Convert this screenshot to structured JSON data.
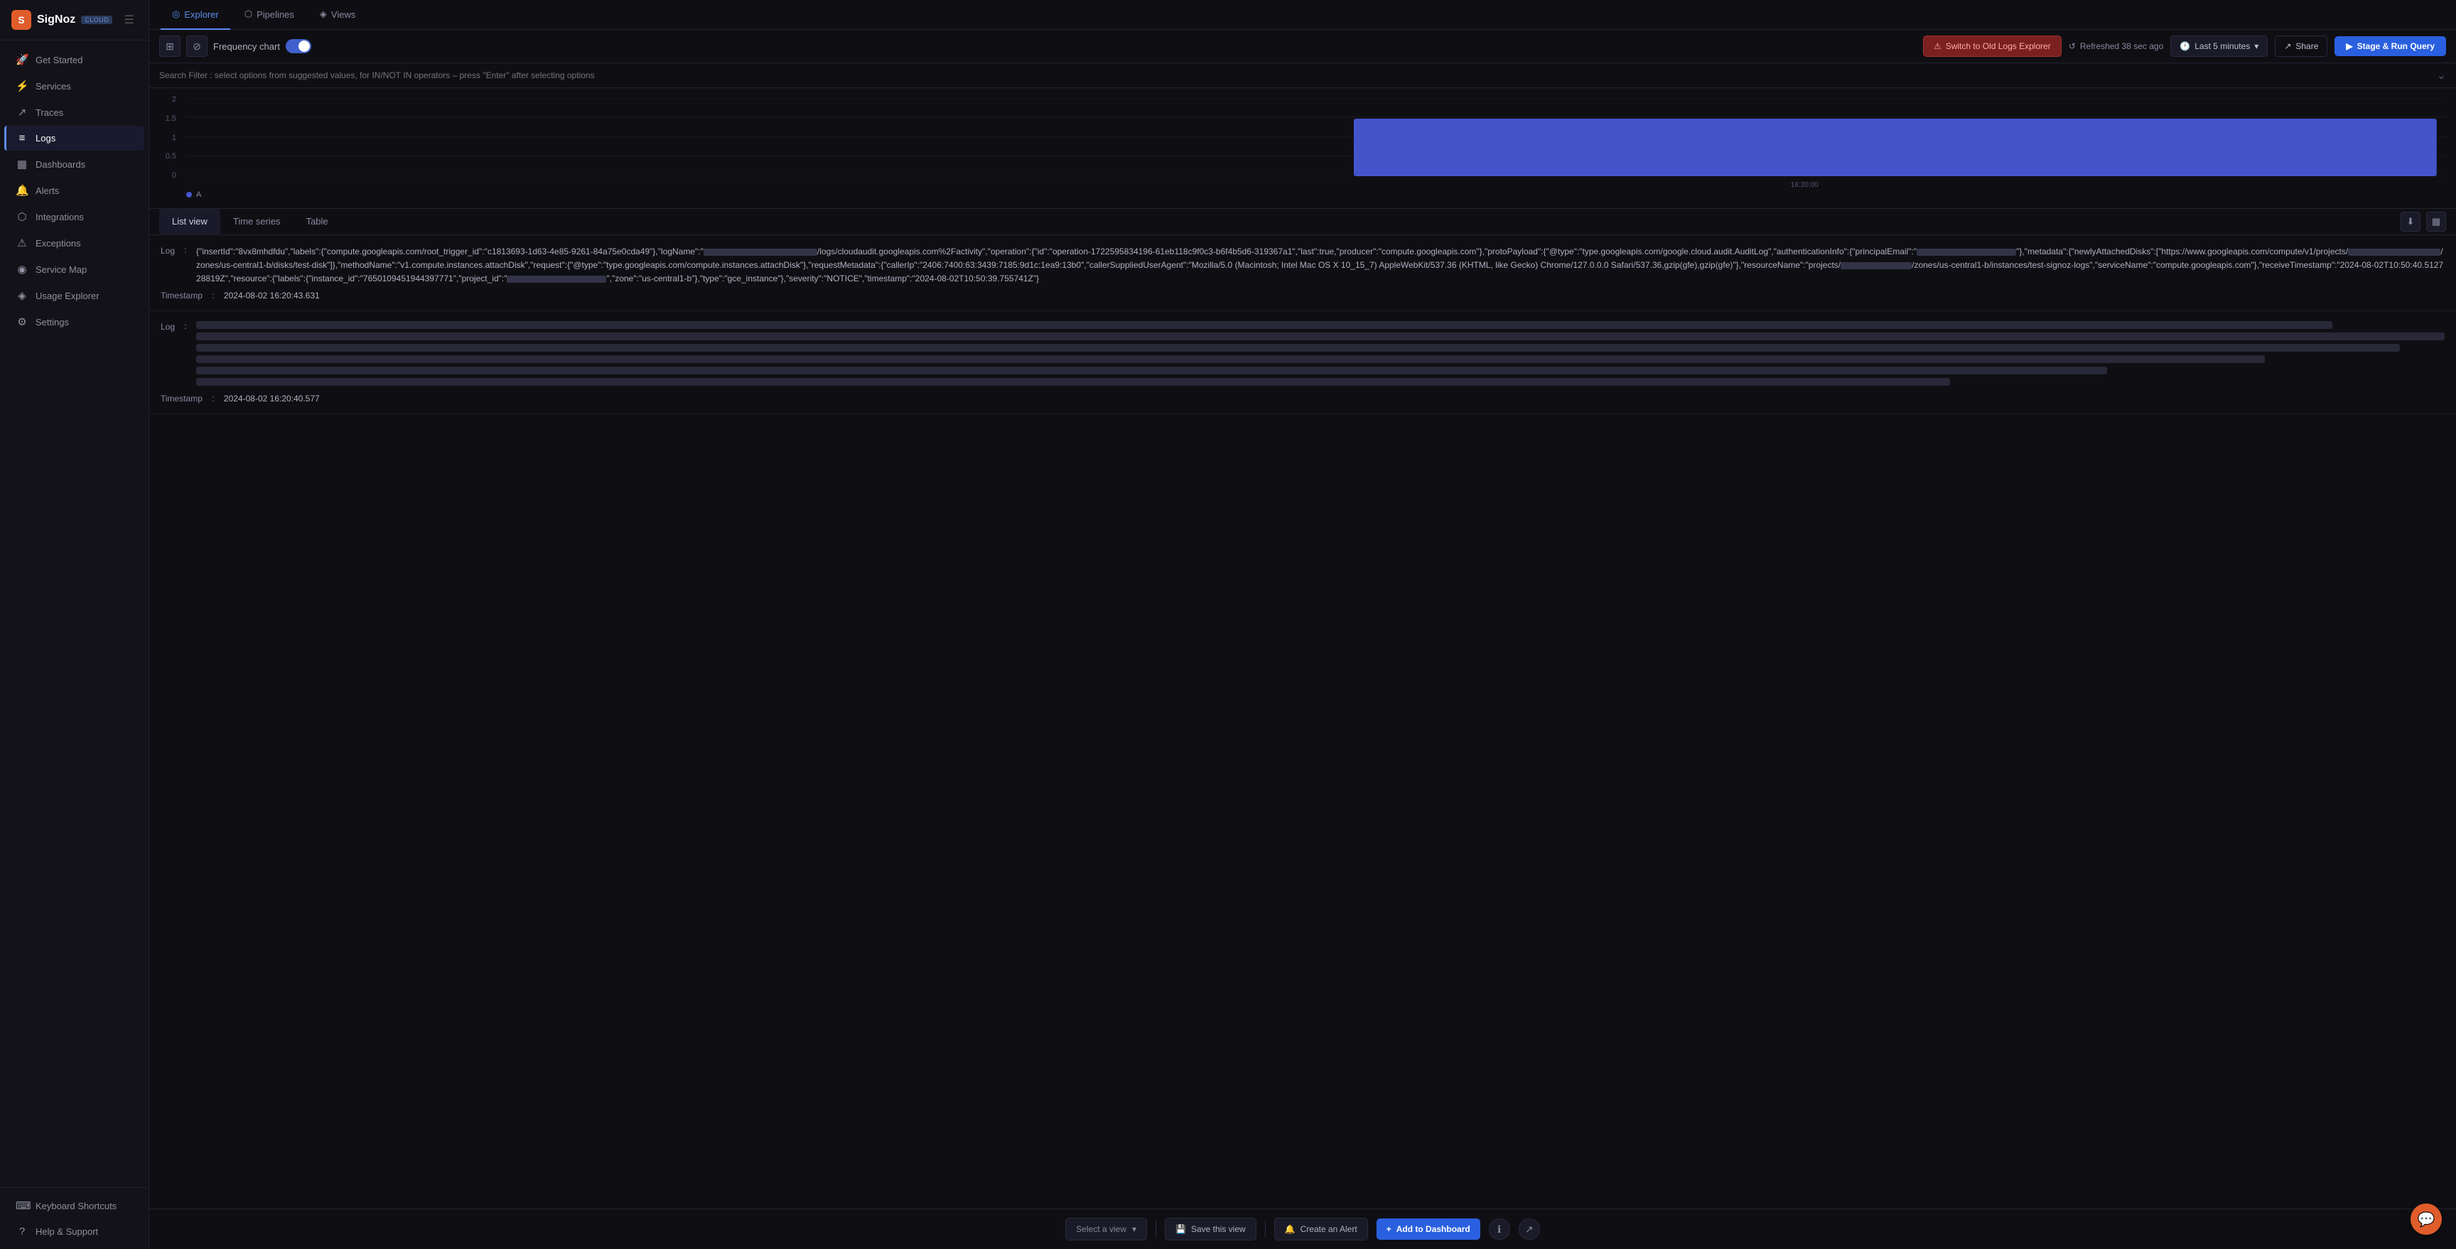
{
  "app": {
    "name": "SigNoz",
    "badge": "CLOUD"
  },
  "sidebar": {
    "items": [
      {
        "id": "get-started",
        "label": "Get Started",
        "icon": "🚀",
        "active": false
      },
      {
        "id": "services",
        "label": "Services",
        "icon": "⚡",
        "active": false
      },
      {
        "id": "traces",
        "label": "Traces",
        "icon": "↗",
        "active": false
      },
      {
        "id": "logs",
        "label": "Logs",
        "icon": "≡",
        "active": true
      },
      {
        "id": "dashboards",
        "label": "Dashboards",
        "icon": "▦",
        "active": false
      },
      {
        "id": "alerts",
        "label": "Alerts",
        "icon": "🔔",
        "active": false
      },
      {
        "id": "integrations",
        "label": "Integrations",
        "icon": "⬡",
        "active": false
      },
      {
        "id": "exceptions",
        "label": "Exceptions",
        "icon": "⚠",
        "active": false
      },
      {
        "id": "service-map",
        "label": "Service Map",
        "icon": "◉",
        "active": false
      },
      {
        "id": "usage-explorer",
        "label": "Usage Explorer",
        "icon": "◈",
        "active": false
      },
      {
        "id": "settings",
        "label": "Settings",
        "icon": "⚙",
        "active": false
      }
    ],
    "bottom_items": [
      {
        "id": "keyboard-shortcuts",
        "label": "Keyboard Shortcuts",
        "icon": "⌨"
      },
      {
        "id": "help-support",
        "label": "Help & Support",
        "icon": "?"
      }
    ]
  },
  "tabs": [
    {
      "id": "explorer",
      "label": "Explorer",
      "icon": "◎",
      "active": true
    },
    {
      "id": "pipelines",
      "label": "Pipelines",
      "icon": "⬡",
      "active": false
    },
    {
      "id": "views",
      "label": "Views",
      "icon": "◈",
      "active": false
    }
  ],
  "toolbar": {
    "freq_chart_label": "Frequency chart",
    "toggle_on": true,
    "switch_old_btn": "Switch to Old Logs Explorer",
    "refresh_text": "Refreshed 38 sec ago",
    "time_range": "Last 5 minutes",
    "share_label": "Share",
    "stage_run_label": "Stage & Run Query"
  },
  "search": {
    "placeholder": "Search Filter : select options from suggested values, for IN/NOT IN operators – press \"Enter\" after selecting options"
  },
  "chart": {
    "y_axis": [
      "2",
      "1.5",
      "1",
      "0.5",
      "0"
    ],
    "x_label": "16:20:00",
    "legend": "A",
    "bar_color": "#4455cc"
  },
  "view_tabs": [
    {
      "id": "list-view",
      "label": "List view",
      "active": true
    },
    {
      "id": "time-series",
      "label": "Time series",
      "active": false
    },
    {
      "id": "table",
      "label": "Table",
      "active": false
    }
  ],
  "logs": [
    {
      "id": "log-1",
      "label": "Log",
      "text": "{\"insertId\":\"8vx8mhdfdu\",\"labels\":{\"compute.googleapis.com/root_trigger_id\":\"c1813693-1d63-4e85-9261-84a75e0cda49\"},\"logName\":\"████████████████████/logs/cloudaudit.googleapis.com%2Factivity\",\"operation\":{\"id\":\"operation-1722595834196-61eb118c9f0c3-b6f4b5d6-319367a1\",\"last\":true,\"producer\":\"compute.googleapis.com\"},\"protoPayload\":{\"@type\":\"type.googleapis.com/google.cloud.audit.AuditLog\",\"authenticationInfo\":{\"principalEmail\":\"████████████████████\"},\"metadata\":{\"newlyAttachedDisks\":[\"https://www.googleapis.com/compute/v1/projects/████████████████████/zones/us-central1-b/disks/test-disk\"]},\"methodName\":\"v1.compute.instances.attachDisk\",\"request\":{\"@type\":\"type.googleapis.com/compute.instances.attachDisk\"},\"requestMetadata\":{\"callerIp\":\"2406:7400:63:3439:7185:9d1c:1ea9:13b0\",\"callerSuppliedUserAgent\":\"Mozilla/5.0 (Macintosh; Intel Mac OS X 10_15_7) AppleWebKit/537.36 (KHTML, like Gecko) Chrome/127.0.0.0 Safari/537.36,gzip(gfe),gzip(gfe)\"},\"resourceName\":\"projects/████████████████████/zones/us-central1-b/instances/test-signoz-logs\",\"serviceName\":\"compute.googleapis.com\"},\"receiveTimestamp\":\"2024-08-02T10:50:40.512728819Z\",\"resource\":{\"labels\":{\"instance_id\":\"7650109451944397771\",\"project_id\":\"████████████████████\",\"zone\":\"us-central1-b\"},\"type\":\"gce_instance\"},\"severity\":\"NOTICE\",\"timestamp\":\"2024-08-02T10:50:39.755741Z\"}",
      "timestamp_label": "Timestamp",
      "timestamp": "2024-08-02 16:20:43.631"
    },
    {
      "id": "log-2",
      "label": "Log",
      "blurred": true,
      "timestamp_label": "Timestamp",
      "timestamp": "2024-08-02 16:20:40.577"
    }
  ],
  "bottom_bar": {
    "select_view_placeholder": "Select a view",
    "save_view_label": "Save this view",
    "create_alert_label": "Create an Alert",
    "add_dashboard_label": "Add to Dashboard"
  }
}
